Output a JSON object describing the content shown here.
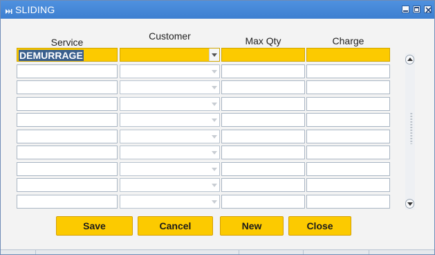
{
  "window": {
    "title": "SLIDING"
  },
  "columns": {
    "service": "Service",
    "customer": "Customer",
    "max_qty": "Max Qty",
    "charge": "Charge"
  },
  "rows": [
    {
      "service": "DEMURRAGE",
      "customer": "",
      "max_qty": "",
      "charge": "",
      "current": true
    },
    {
      "service": "",
      "customer": "",
      "max_qty": "",
      "charge": ""
    },
    {
      "service": "",
      "customer": "",
      "max_qty": "",
      "charge": ""
    },
    {
      "service": "",
      "customer": "",
      "max_qty": "",
      "charge": ""
    },
    {
      "service": "",
      "customer": "",
      "max_qty": "",
      "charge": ""
    },
    {
      "service": "",
      "customer": "",
      "max_qty": "",
      "charge": ""
    },
    {
      "service": "",
      "customer": "",
      "max_qty": "",
      "charge": ""
    },
    {
      "service": "",
      "customer": "",
      "max_qty": "",
      "charge": ""
    },
    {
      "service": "",
      "customer": "",
      "max_qty": "",
      "charge": ""
    },
    {
      "service": "",
      "customer": "",
      "max_qty": "",
      "charge": ""
    }
  ],
  "buttons": {
    "save": "Save",
    "cancel": "Cancel",
    "new": "New",
    "close": "Close"
  },
  "colors": {
    "titlebar": "#3d7fd0",
    "highlight_field": "#fcca00",
    "selection": "#3a5f8e"
  },
  "icons": {
    "window_menu": "window-menu-icon",
    "minimize": "minimize-icon",
    "maximize": "maximize-icon",
    "close": "close-icon"
  }
}
